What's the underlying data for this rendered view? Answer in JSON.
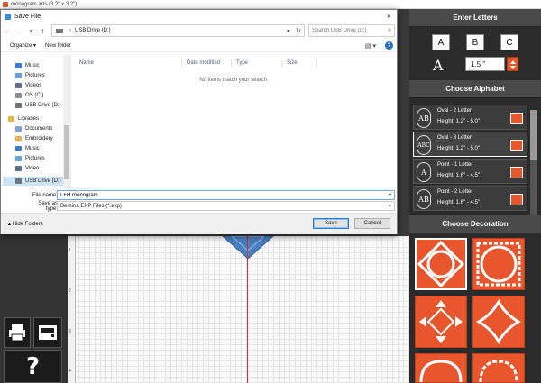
{
  "app": {
    "title": "monogram.arts (3.2\" x 3.2\")"
  },
  "dialog": {
    "title": "Save File",
    "close_glyph": "×",
    "path_root": "USB Drive (D:)",
    "path_sep": "›",
    "search_placeholder": "Search USB Drive (D:)",
    "organize_label": "Organize ▾",
    "new_folder_label": "New folder",
    "nav_items": [
      {
        "label": "Music",
        "color": "#3a7bd5"
      },
      {
        "label": "Pictures",
        "color": "#6aa0e0"
      },
      {
        "label": "Videos",
        "color": "#5c6e8a"
      },
      {
        "label": "OS (C:)",
        "color": "#8a8f96"
      },
      {
        "label": "USB Drive (D:)",
        "color": "#6f737a"
      },
      {
        "label": "Libraries",
        "color": "#e3b450"
      },
      {
        "label": "Documents",
        "color": "#7fa4d4"
      },
      {
        "label": "Embroidery",
        "color": "#e3b450"
      },
      {
        "label": "Music",
        "color": "#3a7bd5"
      },
      {
        "label": "Pictures",
        "color": "#6aa0e0"
      },
      {
        "label": "Video",
        "color": "#5c6e8a"
      },
      {
        "label": "USB Drive (D:)",
        "color": "#6f737a"
      }
    ],
    "columns": [
      "Name",
      "Date modified",
      "Type",
      "Size"
    ],
    "empty_message": "No items match your search.",
    "file_name_label": "File name:",
    "file_name_value": "LFH monogram",
    "save_type_label": "Save as type:",
    "save_type_value": "Bernina EXP Files (*.exp)",
    "hide_folders_label": "Hide Folders",
    "save_button": "Save",
    "cancel_button": "Cancel"
  },
  "right_panel": {
    "enter_letters_header": "Enter Letters",
    "letters": [
      "A",
      "B",
      "C"
    ],
    "font_icon_glyph": "A",
    "size_value": "1.5 \"",
    "choose_alphabet_header": "Choose Alphabet",
    "alphabets": [
      {
        "glyph": "AB",
        "name": "Oval - 2 Letter",
        "height": "Height: 1.2\" - 5.0\""
      },
      {
        "glyph": "ABC",
        "name": "Oval - 3 Letter",
        "height": "Height: 1.2\" - 5.0\""
      },
      {
        "glyph": "A",
        "name": "Point - 1 Letter",
        "height": "Height: 1.6\" - 4.5\""
      },
      {
        "glyph": "AB",
        "name": "Point - 2 Letter",
        "height": "Height: 1.6\" - 4.5\""
      }
    ],
    "choose_decoration_header": "Choose Decoration"
  },
  "toolbar": {
    "help_glyph": "?"
  },
  "ruler": {
    "numbers": [
      "1",
      "2",
      "3",
      "4"
    ]
  },
  "colors": {
    "accent": "#e8562e",
    "panel_dark": "#2b2b2b",
    "motif_blue": "#4a7fc0",
    "center_line": "#d23030"
  }
}
